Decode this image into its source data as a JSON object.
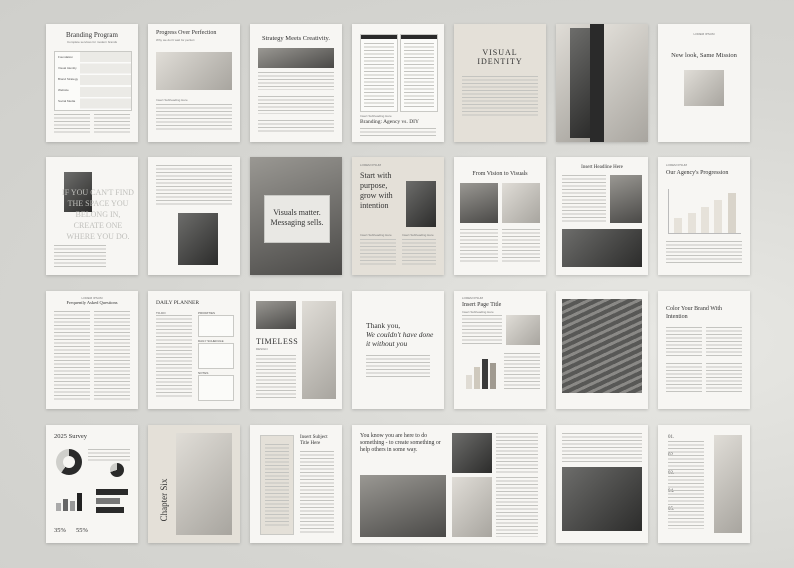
{
  "pages": {
    "branding_program": {
      "title": "Branding Program",
      "subtitle": "Complete services for modern brands",
      "table_rows": [
        "Foundation",
        "Visual Identity",
        "Brand Strategy",
        "Website",
        "Social Media"
      ]
    },
    "progress": {
      "title": "Progress Over Perfection",
      "subtitle": "Why we don't wait for perfect",
      "footer_label": "Insert Subheading Here"
    },
    "strategy": {
      "title": "Strategy Meets Creativity."
    },
    "branding_vs_diy": {
      "eyebrow": "Insert Subheading Here",
      "title": "Branding: Agency vs. DIY"
    },
    "visual_identity": {
      "title": "VISUAL IDENTITY"
    },
    "new_look": {
      "title": "New look, Same Mission",
      "eyebrow": "LOREM IPSUM"
    },
    "if_you_cant": {
      "quote": "IF YOU CAN'T FIND THE SPACE YOU BELONG IN, CREATE ONE WHERE YOU DO."
    },
    "visuals_matter": {
      "title": "Visuals matter. Messaging sells."
    },
    "start_with_purpose": {
      "eyebrow": "LOREM IPSUM",
      "title": "Start with purpose, grow with intention",
      "sub1": "Insert Subheading Here",
      "sub2": "Insert Subheading Here"
    },
    "vision_to_visuals": {
      "title": "From Vision to Visuals"
    },
    "insert_headline": {
      "title": "Insert Headline Here"
    },
    "agency_progression": {
      "eyebrow": "LOREM IPSUM",
      "title": "Our Agency's Progression",
      "bar_values": [
        0.35,
        0.45,
        0.6,
        0.75,
        0.9
      ]
    },
    "faq": {
      "eyebrow": "LOREM IPSUM",
      "title": "Frequently Asked Questions"
    },
    "daily_planner": {
      "title": "DAILY PLANNER",
      "col1": "TO-DO",
      "col2": "PRIORITIES",
      "col3": "DAILY SCHEDULE",
      "col4": "NOTES"
    },
    "timeless": {
      "title": "TIMELESS",
      "subtitle": "DESIGN"
    },
    "thank_you": {
      "line1": "Thank you,",
      "line2": "We couldn't have done it without you"
    },
    "insert_page_title": {
      "eyebrow": "LOREM IPSUM",
      "title": "Insert Page Title",
      "sub": "Insert Subheading Here"
    },
    "color_your_brand": {
      "title": "Color Your Brand With Intention"
    },
    "survey": {
      "title": "2025 Survey",
      "stat1": "35%",
      "stat2": "55%"
    },
    "chapter_six": {
      "title": "Chapter Six"
    },
    "insert_subject": {
      "title": "Insert Subject Title Here"
    },
    "you_know": {
      "title": "You know you are here to do something - to create something or help others in some way."
    },
    "numbered_list": {
      "items": [
        "01.",
        "02.",
        "03.",
        "04.",
        "05."
      ]
    }
  }
}
